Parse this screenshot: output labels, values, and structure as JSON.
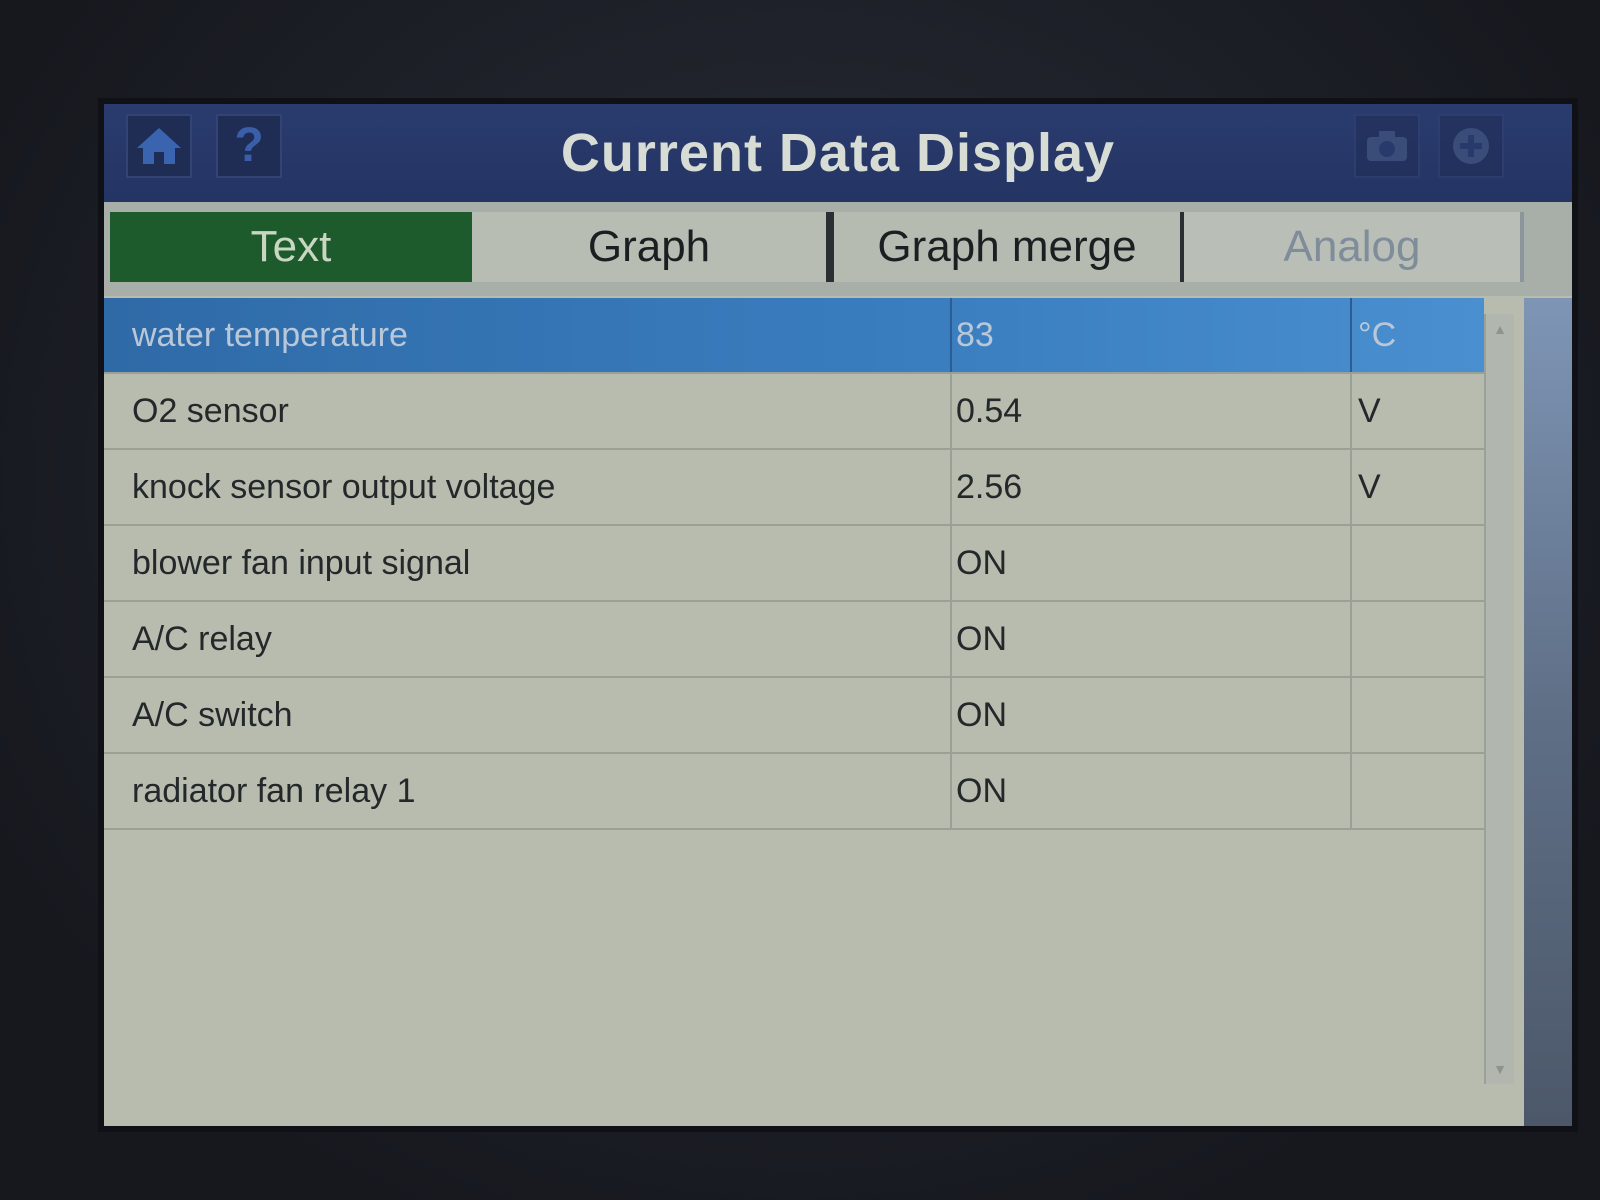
{
  "header": {
    "title": "Current Data Display",
    "home_icon": "home-icon",
    "help_label": "?",
    "camera_icon": "camera-icon",
    "plus_icon": "plus-icon"
  },
  "tabs": [
    {
      "label": "Text",
      "active": true
    },
    {
      "label": "Graph",
      "active": false
    },
    {
      "label": "Graph merge",
      "active": false
    },
    {
      "label": "Analog",
      "active": false
    }
  ],
  "rows": [
    {
      "name": "water temperature",
      "value": "83",
      "unit": "°C",
      "selected": true
    },
    {
      "name": "O2 sensor",
      "value": "0.54",
      "unit": "V",
      "selected": false
    },
    {
      "name": "knock sensor output voltage",
      "value": "2.56",
      "unit": "V",
      "selected": false
    },
    {
      "name": "blower fan input signal",
      "value": "ON",
      "unit": "",
      "selected": false
    },
    {
      "name": "A/C relay",
      "value": "ON",
      "unit": "",
      "selected": false
    },
    {
      "name": "A/C switch",
      "value": "ON",
      "unit": "",
      "selected": false
    },
    {
      "name": "radiator fan relay 1",
      "value": "ON",
      "unit": "",
      "selected": false
    }
  ],
  "colors": {
    "title_bar": "#243463",
    "active_tab": "#1d5a2c",
    "selected_row": "#3a7ec0",
    "table_bg": "#b7bcae"
  }
}
